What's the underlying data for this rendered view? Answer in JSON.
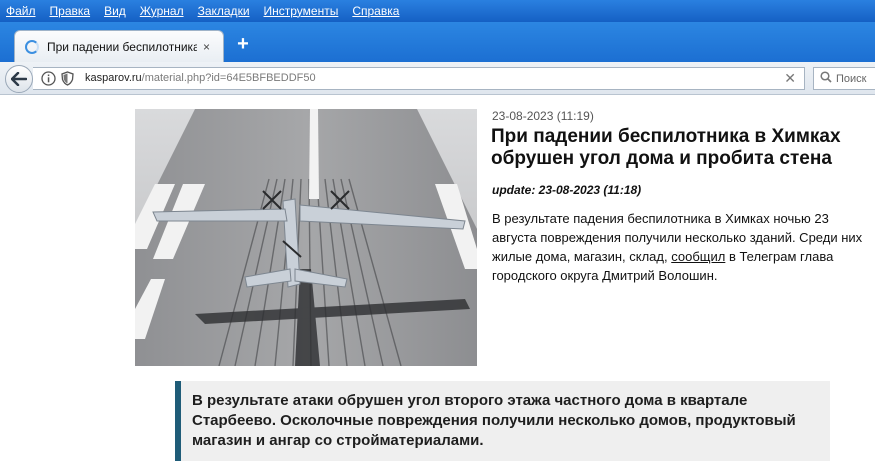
{
  "menu": {
    "items": [
      "Файл",
      "Правка",
      "Вид",
      "Журнал",
      "Закладки",
      "Инструменты",
      "Справка"
    ]
  },
  "tabs": [
    {
      "title": "При падении беспилотника ...",
      "close": "×"
    }
  ],
  "newtab_label": "+",
  "address": {
    "host": "kasparov.ru",
    "path": "/material.php?id=64E5BFBEDDF50",
    "clear": "✕"
  },
  "search": {
    "placeholder": "Поиск"
  },
  "article": {
    "date": "23-08-2023 (11:19)",
    "title": "При падении беспилотника в Химках обрушен угол дома и пробита стена",
    "update": "update: 23-08-2023 (11:18)",
    "lead_before": "В результате падения беспилотника в Химках ночью 23 августа повреждения получили несколько зданий. Среди них жилые дома, магазин, склад, ",
    "lead_link": "сообщил",
    "lead_after": " в Телеграм глава городского округа Дмитрий Волошин.",
    "quote": "В результате атаки обрушен угол второго этажа частного дома в квартале Старбеево. Осколочные повреждения получили несколько домов, продуктовый магазин и ангар со стройматериалами."
  },
  "icons": {
    "back": "back-arrow-icon",
    "info": "info-icon",
    "shield": "shield-icon",
    "search": "search-icon",
    "tab_loading": "loading-icon"
  },
  "colors": {
    "menubar": "#1a6fd0",
    "quote_border": "#1f5c78",
    "quote_bg": "#efefef"
  }
}
